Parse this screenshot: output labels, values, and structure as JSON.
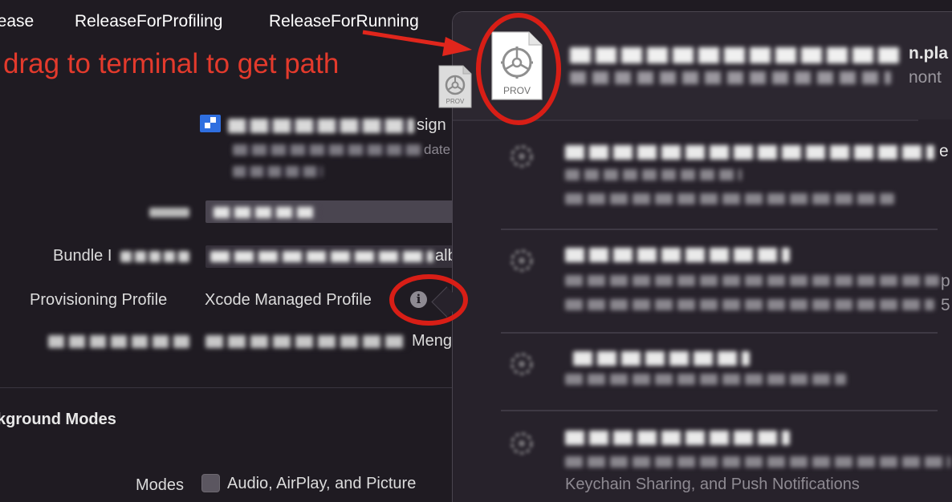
{
  "config_tabs": [
    "lease",
    "ReleaseForProfiling",
    "ReleaseForRunning"
  ],
  "annotation": "drag to terminal to get path",
  "signing": {
    "signing_suffix": "sign",
    "update_suffix": "date",
    "bundle_label_visible": "Bundle I",
    "bundle_value_suffix": "alb",
    "provisioning_label": "Provisioning Profile",
    "provisioning_value": "Xcode Managed Profile",
    "cert_suffix": "Meng"
  },
  "background_modes": {
    "section_title": "kground Modes",
    "modes_label": "Modes",
    "audio_label": "Audio, AirPlay, and Picture"
  },
  "popover": {
    "header_title_suffix": "n.pla",
    "header_sub_suffix": "nont",
    "item2_line2_suffix": "p",
    "item2_line3_suffix": "5",
    "item1_title_suffix": "e",
    "footer": "Keychain Sharing, and Push Notifications"
  },
  "icons": {
    "prov_label": "PROV",
    "info": "i"
  },
  "colors": {
    "annotation_red": "#e33a2c",
    "circle_red": "#d81e16",
    "arrow_red": "#e0261c",
    "team_badge_blue": "#2f6fe0"
  }
}
